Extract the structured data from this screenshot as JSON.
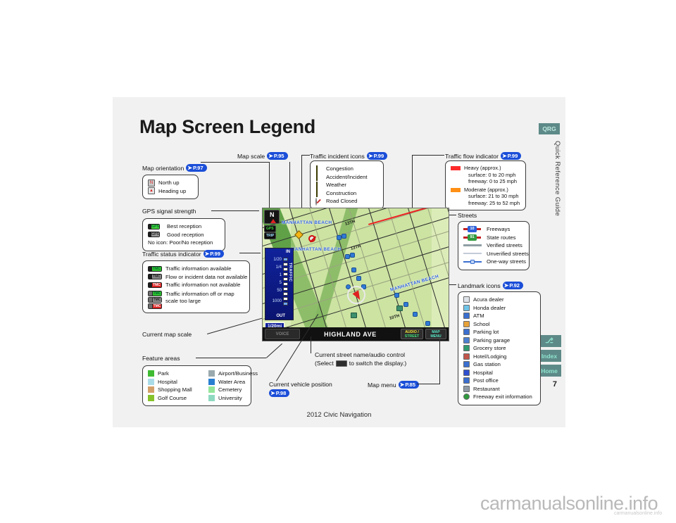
{
  "page": {
    "title": "Map Screen Legend",
    "footer": "2012 Civic Navigation",
    "page_number": "7",
    "rail": {
      "qrg_tab": "QRG",
      "vertical_text": "Quick Reference Guide",
      "buttons": [
        {
          "label": "⎇",
          "name": "nav-icon-button"
        },
        {
          "label": "Index",
          "name": "index-button"
        },
        {
          "label": "Home",
          "name": "home-button"
        }
      ]
    },
    "watermark": "carmanualsonline.info",
    "watermark_small": "carmanualsonline.info"
  },
  "callouts": {
    "map_orientation": {
      "label": "Map orientation",
      "ref": "P.97"
    },
    "gps_signal_strength": {
      "label": "GPS signal strength",
      "ref": ""
    },
    "traffic_status_indicator": {
      "label": "Traffic status indicator",
      "ref": "P.99"
    },
    "current_map_scale": {
      "label": "Current map scale",
      "ref": ""
    },
    "feature_areas": {
      "label": "Feature areas",
      "ref": ""
    },
    "map_scale": {
      "label": "Map scale",
      "ref": "P.95"
    },
    "traffic_incident_icons": {
      "label": "Traffic incident icons",
      "ref": "P.99"
    },
    "traffic_flow_indicator": {
      "label": "Traffic flow indicator",
      "ref": "P.99"
    },
    "streets": {
      "label": "Streets",
      "ref": ""
    },
    "landmark_icons": {
      "label": "Landmark icons",
      "ref": "P.92"
    },
    "current_vehicle_position": {
      "label": "Current vehicle position",
      "ref": "P.98"
    },
    "map_menu": {
      "label": "Map menu",
      "ref": "P.85"
    },
    "current_street_name": {
      "line1": "Current street name/audio control",
      "line2_pre": "(Select",
      "line2_post": "to switch the display.)"
    }
  },
  "legends": {
    "map_orientation": [
      {
        "label": "North up",
        "icon": "north-up-icon"
      },
      {
        "label": "Heading up",
        "icon": "heading-up-icon"
      }
    ],
    "gps_signal": [
      {
        "label": "Best reception",
        "icon": "gps-best-icon",
        "color": "#43d43a"
      },
      {
        "label": "Good reception",
        "icon": "gps-good-icon",
        "color": "#9a9a9a"
      },
      {
        "label": "No icon: Poor/No reception",
        "icon": "",
        "color": ""
      }
    ],
    "traffic_status": [
      {
        "label": "Traffic information available",
        "icon": "tmc-green-icon",
        "color": "#2fc42f"
      },
      {
        "label": "Flow or incident data not available",
        "icon": "tmc-gray-icon",
        "color": "#8f8f8f"
      },
      {
        "label": "Traffic information not available",
        "icon": "tmc-red-icon",
        "color": "#dd2222"
      },
      {
        "label": "Traffic information off or map scale too large",
        "icon": "tmc-off-icons",
        "color": "#2fc42f"
      }
    ],
    "traffic_status_off_icons": [
      {
        "color": "#2fc42f",
        "text": "TMC"
      },
      {
        "color": "#8f8f8f",
        "text": "TMC"
      },
      {
        "color": "#dd2222",
        "text": "TMC"
      }
    ],
    "feature_areas": [
      {
        "label": "Park",
        "color": "#3fbb33"
      },
      {
        "label": "Hospital",
        "color": "#aadce8"
      },
      {
        "label": "Shopping Mall",
        "color": "#d4a06a"
      },
      {
        "label": "Golf Course",
        "color": "#86c22a"
      },
      {
        "label": "Airport/Business",
        "color": "#9aa9ad"
      },
      {
        "label": "Water Area",
        "color": "#2a7fd1"
      },
      {
        "label": "Cemetery",
        "color": "#95e69a"
      },
      {
        "label": "University",
        "color": "#8fd9c0"
      }
    ],
    "traffic_incidents": [
      {
        "label": "Congestion",
        "icon": "congestion-icon",
        "color": "#e8c20a"
      },
      {
        "label": "Accident/Incident",
        "icon": "accident-icon",
        "color": "#f2d40c"
      },
      {
        "label": "Weather",
        "icon": "weather-icon",
        "color": "#e8c20a"
      },
      {
        "label": "Construction",
        "icon": "construction-icon",
        "color": "#c43a1a"
      },
      {
        "label": "Road Closed",
        "icon": "road-closed-icon",
        "color": "#cf2020"
      }
    ],
    "traffic_flow": [
      {
        "color": "#ff2b2b",
        "title": "Heavy (approx.)",
        "line2": "surface: 0 to 20 mph",
        "line3": "freeway: 0 to 25 mph"
      },
      {
        "color": "#ff9015",
        "title": "Moderate (approx.)",
        "line2": "surface: 21 to 30 mph",
        "line3": "freeway: 25 to 52 mph"
      }
    ],
    "streets": [
      {
        "label": "Freeways",
        "icon": "freeway-shield-icon",
        "shield_text": "10",
        "shield_color": "#2b5fd9",
        "line_color": "#c32020"
      },
      {
        "label": "State routes",
        "icon": "state-route-shield-icon",
        "shield_text": "91",
        "shield_color": "#2f9a3e",
        "line_color": "#c32020"
      },
      {
        "label": "Verified streets",
        "icon": "verified-street-line",
        "line_color": "#8f9fa5"
      },
      {
        "label": "Unverified streets",
        "icon": "unverified-street-line",
        "line_color": "#c3cad8"
      },
      {
        "label": "One-way streets",
        "icon": "one-way-street-line",
        "line_color": "#3a6fd0"
      }
    ],
    "landmarks": [
      {
        "label": "Acura dealer",
        "icon": "acura-dealer-icon",
        "color": "#dfe4ea"
      },
      {
        "label": "Honda dealer",
        "icon": "honda-dealer-icon",
        "color": "#6fc4e8"
      },
      {
        "label": "ATM",
        "icon": "atm-icon",
        "color": "#3a6fd0"
      },
      {
        "label": "School",
        "icon": "school-icon",
        "color": "#e8a23a"
      },
      {
        "label": "Parking lot",
        "icon": "parking-lot-icon",
        "color": "#3a6fd0"
      },
      {
        "label": "Parking garage",
        "icon": "parking-garage-icon",
        "color": "#4a7fd0"
      },
      {
        "label": "Grocery store",
        "icon": "grocery-store-icon",
        "color": "#2f9a6e"
      },
      {
        "label": "Hotel/Lodging",
        "icon": "hotel-icon",
        "color": "#c2554a"
      },
      {
        "label": "Gas station",
        "icon": "gas-station-icon",
        "color": "#3a6fd0"
      },
      {
        "label": "Hospital",
        "icon": "hospital-icon",
        "color": "#2f4fd0"
      },
      {
        "label": "Post office",
        "icon": "post-office-icon",
        "color": "#3a6fd0"
      },
      {
        "label": "Restaurant",
        "icon": "restaurant-icon",
        "color": "#8f9aa5"
      },
      {
        "label": "Freeway exit information",
        "icon": "freeway-exit-icon",
        "color": "#2f9a3e"
      }
    ]
  },
  "nav_screen": {
    "zoom_panel": {
      "in_label": "IN",
      "out_label": "OUT",
      "traffic_label": "TRAFFIC",
      "levels": [
        "1/20",
        "1/4",
        "1",
        "5",
        "50",
        "1000"
      ]
    },
    "scale_value": "1/20mi",
    "north_icon": "N",
    "gps_badge": "GPS",
    "trip_badge": "TRIP",
    "bottom_bar": {
      "voice": "VOICE",
      "street_name": "HIGHLAND AVE",
      "audio_street_line1": "AUDIO /",
      "audio_street_line2": "STREET",
      "map_menu_line1": "MAP",
      "map_menu_line2": "MENU"
    },
    "map_labels": [
      {
        "text": "MANHATTAN BEACH"
      },
      {
        "text": "MANHATTAN BEACH"
      },
      {
        "text": "MANHATTAN BEACH"
      }
    ],
    "street_labels": [
      "13TH",
      "13TH",
      "10TH"
    ]
  }
}
